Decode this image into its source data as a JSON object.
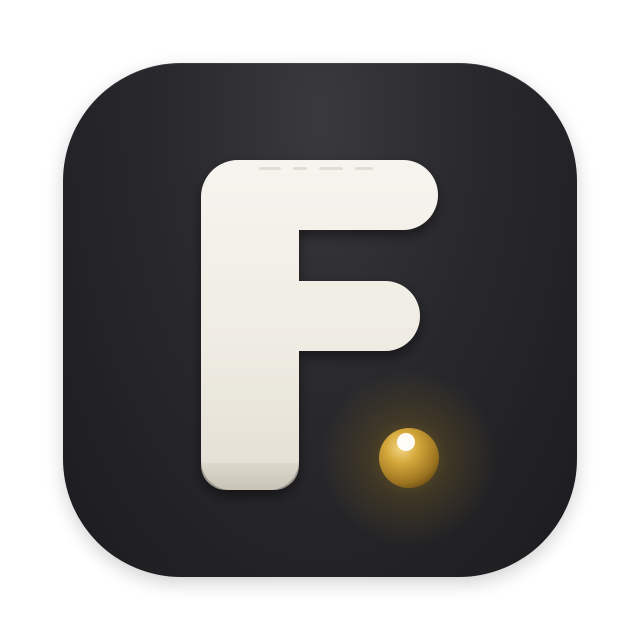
{
  "icon": {
    "glyph": "F",
    "background_color": "#26262a",
    "letter_color": "#f1efe8",
    "dot_color": "#c89a2e",
    "dot_glow_color": "#8a6a1a"
  }
}
